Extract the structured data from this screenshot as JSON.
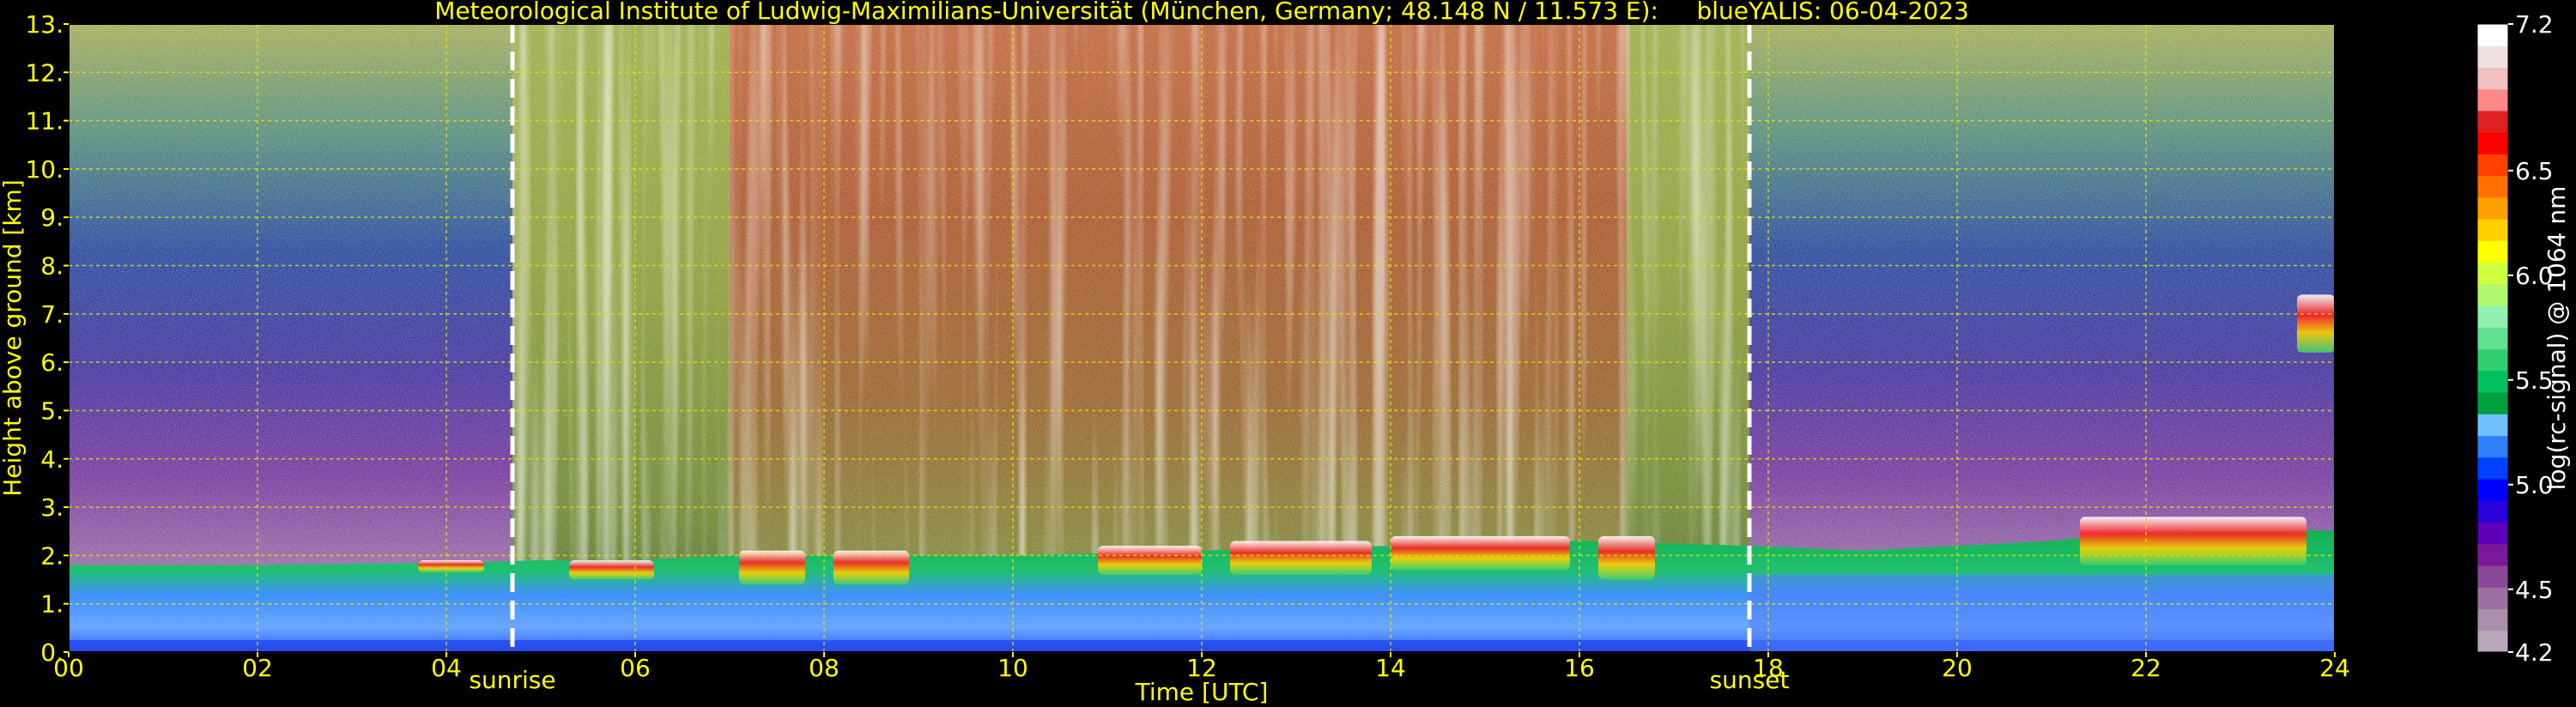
{
  "chart_data": {
    "type": "heatmap",
    "title": "Meteorological Institute of Ludwig-Maximilians-Universität (München, Germany; 48.148 N / 11.573 E):     blueYALIS: 06-04-2023",
    "xlabel": "Time [UTC]",
    "ylabel": "Height above ground [km]",
    "xlim": [
      0,
      24
    ],
    "ylim": [
      0,
      13
    ],
    "x_ticks": [
      0,
      2,
      4,
      6,
      8,
      10,
      12,
      14,
      16,
      18,
      20,
      22,
      24
    ],
    "x_tick_labels": [
      "00",
      "02",
      "04",
      "06",
      "08",
      "10",
      "12",
      "14",
      "16",
      "18",
      "20",
      "22",
      "24"
    ],
    "y_ticks": [
      0,
      1,
      2,
      3,
      4,
      5,
      6,
      7,
      8,
      9,
      10,
      11,
      12,
      13
    ],
    "y_tick_labels": [
      "0.",
      "1.",
      "2.",
      "3.",
      "4.",
      "5.",
      "6.",
      "7.",
      "8.",
      "9.",
      "10.",
      "11.",
      "12.",
      "13."
    ],
    "grid": true,
    "markers": [
      {
        "label": "sunrise",
        "x": 4.7
      },
      {
        "label": "sunset",
        "x": 17.8
      }
    ],
    "colorbar": {
      "label": "log(rc-signal) @ 1064 nm",
      "range": [
        4.2,
        7.2
      ],
      "tick_values": [
        4.2,
        4.5,
        5.0,
        5.5,
        6.0,
        6.5,
        7.2
      ],
      "tick_labels": [
        "4.2",
        "4.5",
        "5.0",
        "5.5",
        "6.0",
        "6.5",
        "7.2"
      ],
      "colors": [
        "#b8a8b8",
        "#a890a8",
        "#9a70a0",
        "#8a4898",
        "#7a1a9a",
        "#6000b8",
        "#2a00dd",
        "#0000ff",
        "#0040ff",
        "#3080ff",
        "#70c0ff",
        "#00a040",
        "#00c060",
        "#30d070",
        "#60e090",
        "#90f0b0",
        "#b0f870",
        "#d0ff40",
        "#ffff00",
        "#ffd000",
        "#ffa000",
        "#ff7000",
        "#ff4000",
        "#ff0000",
        "#e02020",
        "#ff8888",
        "#f0c0c0",
        "#f0e0e0",
        "#ffffff"
      ]
    },
    "boundary_layer_top_km": [
      {
        "x": 0,
        "y": 1.8
      },
      {
        "x": 2,
        "y": 1.8
      },
      {
        "x": 4,
        "y": 1.85
      },
      {
        "x": 5,
        "y": 1.9
      },
      {
        "x": 6,
        "y": 1.9
      },
      {
        "x": 7,
        "y": 2.0
      },
      {
        "x": 8,
        "y": 2.0
      },
      {
        "x": 10,
        "y": 2.0
      },
      {
        "x": 12,
        "y": 2.1
      },
      {
        "x": 14,
        "y": 2.2
      },
      {
        "x": 16,
        "y": 2.3
      },
      {
        "x": 17.8,
        "y": 2.2
      },
      {
        "x": 19,
        "y": 2.1
      },
      {
        "x": 21,
        "y": 2.3
      },
      {
        "x": 22,
        "y": 2.5
      },
      {
        "x": 23,
        "y": 2.6
      },
      {
        "x": 24,
        "y": 2.5
      }
    ],
    "cloud_features": [
      {
        "x_start": 3.7,
        "x_end": 4.4,
        "y_bottom": 1.65,
        "y_top": 1.9,
        "value": 6.3
      },
      {
        "x_start": 5.3,
        "x_end": 6.2,
        "y_bottom": 1.5,
        "y_top": 1.9,
        "value": 6.1
      },
      {
        "x_start": 7.1,
        "x_end": 7.8,
        "y_bottom": 1.4,
        "y_top": 2.1,
        "value": 6.6
      },
      {
        "x_start": 8.1,
        "x_end": 8.9,
        "y_bottom": 1.4,
        "y_top": 2.1,
        "value": 6.7
      },
      {
        "x_start": 10.9,
        "x_end": 12.0,
        "y_bottom": 1.6,
        "y_top": 2.2,
        "value": 6.3
      },
      {
        "x_start": 12.3,
        "x_end": 13.8,
        "y_bottom": 1.6,
        "y_top": 2.3,
        "value": 6.3
      },
      {
        "x_start": 14.0,
        "x_end": 15.9,
        "y_bottom": 1.7,
        "y_top": 2.4,
        "value": 6.3
      },
      {
        "x_start": 16.2,
        "x_end": 16.8,
        "y_bottom": 1.5,
        "y_top": 2.4,
        "value": 6.0
      },
      {
        "x_start": 21.3,
        "x_end": 23.7,
        "y_bottom": 1.8,
        "y_top": 2.8,
        "value": 6.8
      },
      {
        "x_start": 23.6,
        "x_end": 24.0,
        "y_bottom": 6.2,
        "y_top": 7.4,
        "value": 6.2
      }
    ]
  }
}
